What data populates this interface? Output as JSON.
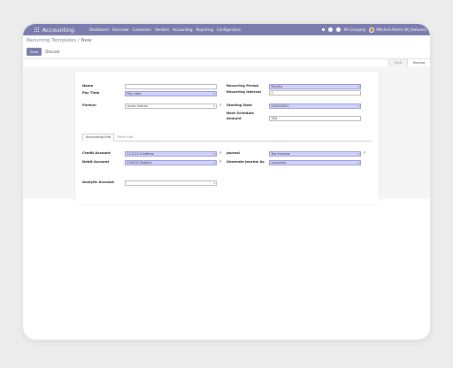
{
  "navbar": {
    "app_name": "Accounting",
    "menu": [
      "Dashboard",
      "Overview",
      "Customers",
      "Vendors",
      "Accounting",
      "Reporting",
      "Configuration"
    ],
    "company": "IN Company",
    "user": "Mitchell Admin (dt_features)"
  },
  "breadcrumb": {
    "parent": "Recurring Templates",
    "separator": " / ",
    "current": "New"
  },
  "buttons": {
    "save": "Save",
    "discard": "Discard"
  },
  "status": {
    "stages": [
      "Draft",
      "Running"
    ],
    "active": "Running"
  },
  "form": {
    "name": {
      "label": "Name",
      "value": ""
    },
    "pay_time": {
      "label": "Pay Time",
      "value": "Pay Later"
    },
    "partner": {
      "label": "Partner",
      "value": "Azure Interior"
    },
    "recurring_period": {
      "label": "Recurring Period",
      "value": "Months"
    },
    "recurring_interval": {
      "label": "Recurring Interval",
      "value": "1"
    },
    "starting_date": {
      "label": "Starting Date",
      "value": "04/30/2021"
    },
    "next_schedule_line1": "Next Schedule",
    "next_schedule_line2": "Amount",
    "next_schedule_value": "300",
    "tabs": [
      "Accounting Info",
      "Other Info"
    ],
    "credit_account": {
      "label": "Credit Account",
      "value": "111210 Creditors"
    },
    "debit_account": {
      "label": "Debit Account",
      "value": "100400 Debtors"
    },
    "journal": {
      "label": "Journal",
      "value": "Tax Invoices"
    },
    "generate_journal_as": {
      "label": "Generate Journal As",
      "value": "Unposted"
    },
    "analytic_account": {
      "label": "Analytic Account",
      "value": ""
    }
  },
  "colors": {
    "brand": "#7c7bad",
    "required_field": "#d2d2ff"
  }
}
